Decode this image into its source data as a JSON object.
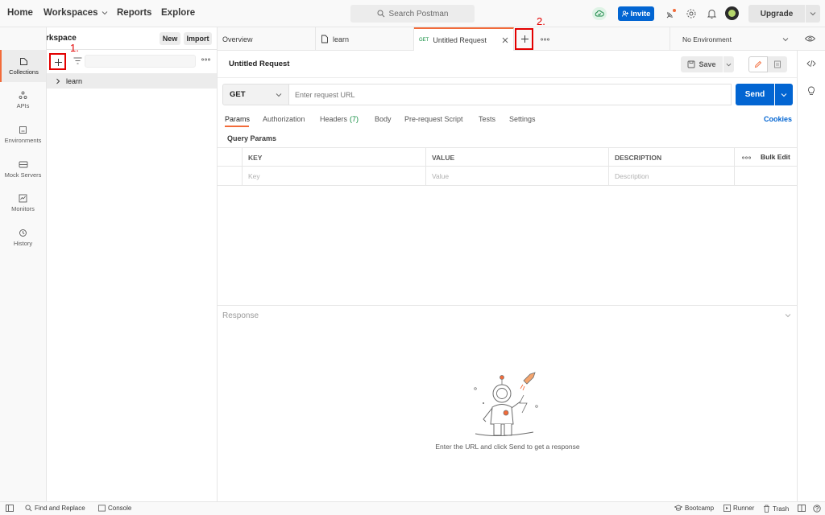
{
  "topnav": {
    "home": "Home",
    "workspaces": "Workspaces",
    "reports": "Reports",
    "explore": "Explore",
    "search_placeholder": "Search Postman",
    "invite": "Invite",
    "upgrade": "Upgrade"
  },
  "workspace": {
    "name": "My Workspace",
    "new_label": "New",
    "import_label": "Import"
  },
  "rail": [
    {
      "label": "Collections",
      "icon": "collections-icon"
    },
    {
      "label": "APIs",
      "icon": "apis-icon"
    },
    {
      "label": "Environments",
      "icon": "environments-icon"
    },
    {
      "label": "Mock Servers",
      "icon": "mock-servers-icon"
    },
    {
      "label": "Monitors",
      "icon": "monitors-icon"
    },
    {
      "label": "History",
      "icon": "history-icon"
    }
  ],
  "collections": [
    {
      "name": "learn"
    }
  ],
  "tabs": {
    "overview": "Overview",
    "learn": "learn",
    "active_method": "GET",
    "active_title": "Untitled Request",
    "environment": "No Environment"
  },
  "request": {
    "title": "Untitled Request",
    "save_label": "Save",
    "method": "GET",
    "url_placeholder": "Enter request URL",
    "send_label": "Send",
    "subtabs": [
      "Params",
      "Authorization",
      "Headers",
      "Body",
      "Pre-request Script",
      "Tests",
      "Settings"
    ],
    "headers_count": "(7)",
    "cookies_label": "Cookies",
    "query_params_label": "Query Params",
    "table": {
      "headers": [
        "KEY",
        "VALUE",
        "DESCRIPTION"
      ],
      "bulk_edit": "Bulk Edit",
      "placeholders": [
        "Key",
        "Value",
        "Description"
      ]
    }
  },
  "response": {
    "label": "Response",
    "empty_message": "Enter the URL and click Send to get a response"
  },
  "statusbar": {
    "find_replace": "Find and Replace",
    "console": "Console",
    "bootcamp": "Bootcamp",
    "runner": "Runner",
    "trash": "Trash"
  },
  "annotations": [
    "1.",
    "2."
  ],
  "colors": {
    "accent": "#f26b3a",
    "primary": "#0265d2",
    "annotation": "#e30000",
    "headers_count": "#0a8a3a"
  }
}
